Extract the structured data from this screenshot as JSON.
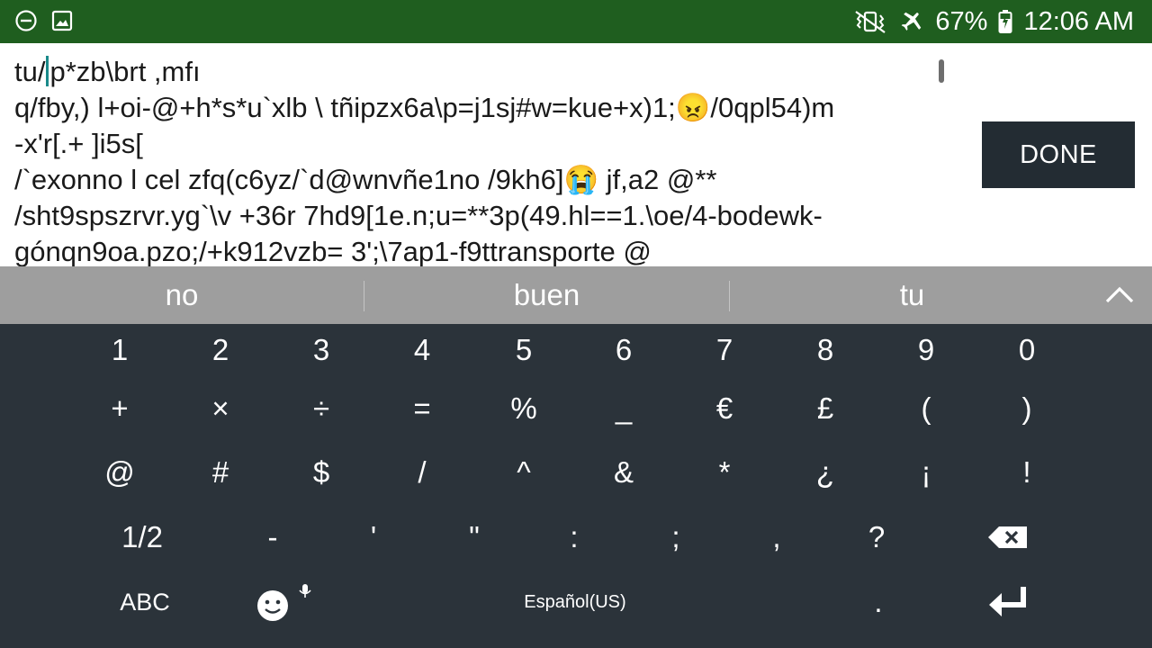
{
  "status_bar": {
    "battery": "67%",
    "time": "12:06 AM",
    "icons": [
      "minus-circle-icon",
      "image-icon",
      "vibrate-icon",
      "airplane-icon",
      "battery-charging-icon"
    ]
  },
  "editor": {
    "before_caret": "tu/",
    "after_caret": "p*zb\\brt ,mfı\nq/fby,) l+oi-@+h*s*u`xlb \\ tñipzx6a\\p=j1sj#w=kue+x)1;😠/0qpl54)m\n-x'r[.+ ]i5s[\n/`exonno l cel zfq(c6yz/`d@wnvñe1no /9kh6]😭 jf,a2 @**\n/sht9spszrvr.yg`\\v +36r 7hd9[1e.n;u=**3p(49.hl==1.\\oe/4-bodewk-\ngónqn9oa.pzo;/+k912vzb= 3';\\7ap1-f9ttransporte @"
  },
  "done_label": "DONE",
  "suggestions": [
    "no",
    "buen",
    "tu"
  ],
  "keyboard": {
    "row1": [
      "1",
      "2",
      "3",
      "4",
      "5",
      "6",
      "7",
      "8",
      "9",
      "0"
    ],
    "row2": [
      "+",
      "×",
      "÷",
      "=",
      "%",
      "_",
      "€",
      "£",
      "(",
      ")"
    ],
    "row3": [
      "@",
      "#",
      "$",
      "/",
      "^",
      "&",
      "*",
      "¿",
      "¡",
      "!"
    ],
    "row4": [
      "1/2",
      "-",
      "'",
      "\"",
      ":",
      ";",
      ",",
      "?"
    ],
    "abc_label": "ABC",
    "language_label": "Español(US)",
    "period": "."
  },
  "colors": {
    "status_bar": "#1f5e1f",
    "keyboard": "#2b333a",
    "suggestion_bar": "#9e9e9e",
    "caret": "#1a8a8a"
  }
}
